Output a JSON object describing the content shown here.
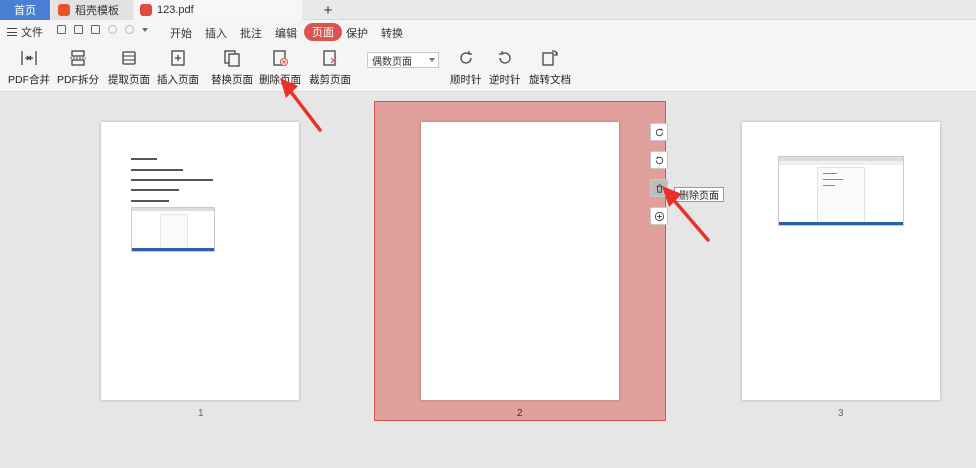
{
  "tabs": [
    {
      "label": "首页"
    },
    {
      "label": "稻壳模板"
    },
    {
      "label": "123.pdf"
    }
  ],
  "menu": {
    "file": "文件",
    "items": [
      "开始",
      "插入",
      "批注",
      "编辑",
      "页面",
      "保护",
      "转换"
    ],
    "active": "页面"
  },
  "toolbar": {
    "tools": [
      {
        "label": "PDF合并",
        "icon": "merge-icon"
      },
      {
        "label": "PDF拆分",
        "icon": "split-icon"
      },
      {
        "label": "提取页面",
        "icon": "extract-icon"
      },
      {
        "label": "插入页面",
        "icon": "insert-page-icon"
      },
      {
        "label": "替换页面",
        "icon": "replace-icon"
      },
      {
        "label": "删除页面",
        "icon": "delete-page-icon"
      },
      {
        "label": "裁剪页面",
        "icon": "crop-icon"
      },
      {
        "label": "顺时针",
        "icon": "rotate-cw-icon"
      },
      {
        "label": "逆时针",
        "icon": "rotate-ccw-icon"
      },
      {
        "label": "旋转文档",
        "icon": "rotate-doc-icon"
      }
    ],
    "page_select": "偶数页面"
  },
  "pages": [
    {
      "number": "1"
    },
    {
      "number": "2"
    },
    {
      "number": "3"
    }
  ],
  "tooltip": "删除页面",
  "colors": {
    "accent": "#d9534f",
    "selection": "#e0a09c",
    "home_tab": "#4a7fd4",
    "arrow": "#e8312a"
  }
}
